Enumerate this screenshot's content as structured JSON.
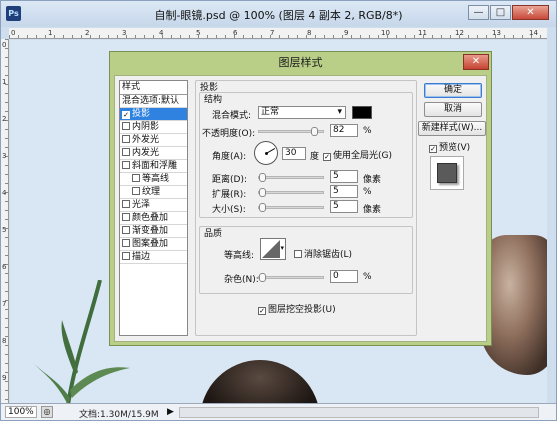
{
  "window": {
    "title": "自制-眼镜.psd @ 100% (图层 4 副本 2, RGB/8*)",
    "app_icon": "Ps",
    "controls": {
      "minimize": "—",
      "maximize": "□",
      "close": "✕"
    }
  },
  "rulers": {
    "top_marks": [
      "0",
      "1",
      "2",
      "3",
      "4",
      "5",
      "6",
      "7",
      "8",
      "9",
      "10",
      "11",
      "12",
      "13",
      "14"
    ],
    "left_marks": [
      "0",
      "1",
      "2",
      "3",
      "4",
      "5",
      "6",
      "7",
      "8",
      "9"
    ]
  },
  "status": {
    "zoom": "100%",
    "doc": "文档:1.30M/15.9M",
    "arrow": "▶"
  },
  "dialog": {
    "title": "图层样式",
    "close": "✕",
    "style_list": {
      "header": "样式",
      "items": [
        {
          "label": "混合选项:默认",
          "checkbox": false,
          "sub": false,
          "selected": false
        },
        {
          "label": "投影",
          "checkbox": true,
          "checked": true,
          "sub": false,
          "selected": true
        },
        {
          "label": "内阴影",
          "checkbox": true,
          "checked": false,
          "sub": false
        },
        {
          "label": "外发光",
          "checkbox": true,
          "checked": false,
          "sub": false
        },
        {
          "label": "内发光",
          "checkbox": true,
          "checked": false,
          "sub": false
        },
        {
          "label": "斜面和浮雕",
          "checkbox": true,
          "checked": false,
          "sub": false
        },
        {
          "label": "等高线",
          "checkbox": true,
          "checked": false,
          "sub": true
        },
        {
          "label": "纹理",
          "checkbox": true,
          "checked": false,
          "sub": true
        },
        {
          "label": "光泽",
          "checkbox": true,
          "checked": false,
          "sub": false
        },
        {
          "label": "颜色叠加",
          "checkbox": true,
          "checked": false,
          "sub": false
        },
        {
          "label": "渐变叠加",
          "checkbox": true,
          "checked": false,
          "sub": false
        },
        {
          "label": "图案叠加",
          "checkbox": true,
          "checked": false,
          "sub": false
        },
        {
          "label": "描边",
          "checkbox": true,
          "checked": false,
          "sub": false
        }
      ]
    },
    "buttons": {
      "ok": "确定",
      "cancel": "取消",
      "new_style": "新建样式(W)...",
      "preview": "预览(V)",
      "preview_checked": true
    },
    "drop_shadow": {
      "section": "投影",
      "structure": "结构",
      "blend_mode_label": "混合模式:",
      "blend_mode_value": "正常",
      "blend_color": "#000000",
      "opacity_label": "不透明度(O):",
      "opacity_value": "82",
      "opacity_unit": "%",
      "angle_label": "角度(A):",
      "angle_value": "30",
      "angle_unit": "度",
      "global_light_label": "使用全局光(G)",
      "global_light_checked": true,
      "distance_label": "距离(D):",
      "distance_value": "5",
      "distance_unit": "像素",
      "spread_label": "扩展(R):",
      "spread_value": "5",
      "spread_unit": "%",
      "size_label": "大小(S):",
      "size_value": "5",
      "size_unit": "像素",
      "quality": "品质",
      "contour_label": "等高线:",
      "anti_alias_label": "消除锯齿(L)",
      "anti_alias_checked": false,
      "noise_label": "杂色(N):",
      "noise_value": "0",
      "noise_unit": "%",
      "knockout_label": "图层挖空投影(U)",
      "knockout_checked": true
    }
  }
}
